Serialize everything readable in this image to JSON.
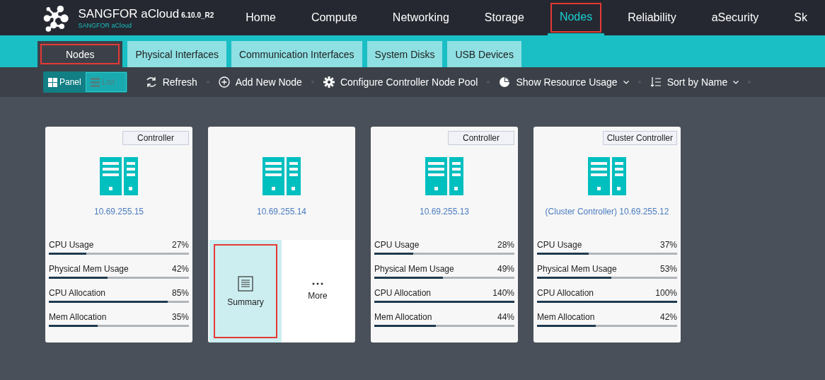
{
  "brand": {
    "title": "SANGFOR aCloud",
    "version": "6.10.0_R2",
    "subtitle": "SANGFOR aCloud"
  },
  "nav": [
    {
      "label": "Home",
      "selected": false,
      "highlighted": false
    },
    {
      "label": "Compute",
      "selected": false,
      "highlighted": false
    },
    {
      "label": "Networking",
      "selected": false,
      "highlighted": false
    },
    {
      "label": "Storage",
      "selected": false,
      "highlighted": false
    },
    {
      "label": "Nodes",
      "selected": true,
      "highlighted": true
    },
    {
      "label": "Reliability",
      "selected": false,
      "highlighted": false
    },
    {
      "label": "aSecurity",
      "selected": false,
      "highlighted": false
    },
    {
      "label": "Sk",
      "selected": false,
      "highlighted": false
    }
  ],
  "tabs": [
    {
      "label": "Nodes",
      "selected": true,
      "highlighted": true
    },
    {
      "label": "Physical Interfaces",
      "selected": false,
      "highlighted": false
    },
    {
      "label": "Communication Interfaces",
      "selected": false,
      "highlighted": false
    },
    {
      "label": "System Disks",
      "selected": false,
      "highlighted": false
    },
    {
      "label": "USB Devices",
      "selected": false,
      "highlighted": false
    }
  ],
  "view_toggle": [
    {
      "label": "Panel",
      "kind": "grid",
      "selected": true
    },
    {
      "label": "List",
      "kind": "list",
      "selected": false
    }
  ],
  "toolbar": [
    {
      "label": "Refresh",
      "kind": "refresh",
      "dropdown": false
    },
    {
      "label": "Add New Node",
      "kind": "add",
      "dropdown": false
    },
    {
      "label": "Configure Controller Node Pool",
      "kind": "gear",
      "dropdown": false
    },
    {
      "label": "Show Resource Usage",
      "kind": "pie",
      "dropdown": true
    },
    {
      "label": "Sort by Name",
      "kind": "sort",
      "dropdown": true
    }
  ],
  "nodes": [
    {
      "kind": "stats",
      "role": "Controller",
      "ip": "10.69.255.15",
      "stats": [
        {
          "label": "CPU Usage",
          "value": "27%",
          "level": 0.27
        },
        {
          "label": "Physical Mem Usage",
          "value": "42%",
          "level": 0.42
        },
        {
          "label": "CPU Allocation",
          "value": "85%",
          "level": 0.85
        },
        {
          "label": "Mem Allocation",
          "value": "35%",
          "level": 0.35
        }
      ]
    },
    {
      "kind": "actions",
      "ip": "10.69.255.14",
      "actions": [
        {
          "label": "Summary",
          "kind": "summary",
          "selected": true,
          "highlighted": true
        },
        {
          "label": "More",
          "kind": "more",
          "selected": false,
          "highlighted": false
        }
      ]
    },
    {
      "kind": "stats",
      "role": "Controller",
      "ip": "10.69.255.13",
      "stats": [
        {
          "label": "CPU Usage",
          "value": "28%",
          "level": 0.28
        },
        {
          "label": "Physical Mem Usage",
          "value": "49%",
          "level": 0.49
        },
        {
          "label": "CPU Allocation",
          "value": "140%",
          "level": 1
        },
        {
          "label": "Mem Allocation",
          "value": "44%",
          "level": 0.44
        }
      ]
    },
    {
      "kind": "stats",
      "role": "Cluster Controller",
      "ip": "(Cluster Controller) 10.69.255.12",
      "stats": [
        {
          "label": "CPU Usage",
          "value": "37%",
          "level": 0.37
        },
        {
          "label": "Physical Mem Usage",
          "value": "53%",
          "level": 0.53
        },
        {
          "label": "CPU Allocation",
          "value": "100%",
          "level": 1
        },
        {
          "label": "Mem Allocation",
          "value": "42%",
          "level": 0.42
        }
      ]
    }
  ]
}
